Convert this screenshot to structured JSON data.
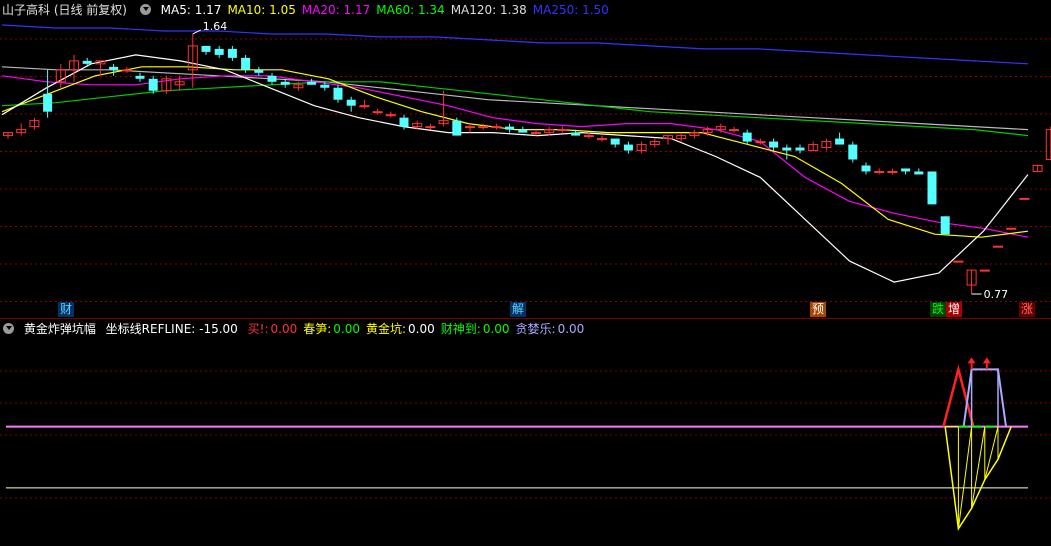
{
  "main_panel": {
    "title": "山子高科 (日线 前复权)",
    "ma_legend": [
      {
        "label": "MA5: 1.17",
        "color": "#ffffff"
      },
      {
        "label": "MA10: 1.05",
        "color": "#ffff00"
      },
      {
        "label": "MA20: 1.17",
        "color": "#ff00ff"
      },
      {
        "label": "MA60: 1.34",
        "color": "#00ff00"
      },
      {
        "label": "MA120: 1.38",
        "color": "#dddddd"
      },
      {
        "label": "MA250: 1.50",
        "color": "#3333ff"
      }
    ],
    "high_label": "1.64",
    "low_label": "0.77",
    "markers": [
      {
        "text": "财",
        "color": "#66ccff",
        "bg": "#003366"
      },
      {
        "text": "解",
        "color": "#66ccff",
        "bg": "#003366"
      },
      {
        "text": "预",
        "color": "#ffffff",
        "bg": "#aa4400"
      },
      {
        "text": "跌",
        "color": "#00ff00",
        "bg": "#004400"
      },
      {
        "text": "增",
        "color": "#ffffff",
        "bg": "#aa0000"
      },
      {
        "text": "涨",
        "color": "#ff6666",
        "bg": "#660000"
      }
    ]
  },
  "indicator_panel": {
    "title": "黄金炸弹坑幅",
    "ref_label": "坐标线REFLINE: -15.00",
    "fields": [
      {
        "label": "买!:",
        "value": "0.00",
        "label_color": "#ff3333",
        "value_color": "#ff3333"
      },
      {
        "label": "春笋:",
        "value": "0.00",
        "label_color": "#ffff00",
        "value_color": "#00ff00"
      },
      {
        "label": "黄金坑:",
        "value": "0.00",
        "label_color": "#ffff00",
        "value_color": "#ffffff"
      },
      {
        "label": "财神到:",
        "value": "0.00",
        "label_color": "#00ff00",
        "value_color": "#00ff00"
      },
      {
        "label": "贪婪乐:",
        "value": "0.00",
        "label_color": "#aaaaff",
        "value_color": "#aaaaff"
      }
    ]
  },
  "chart_data": {
    "type": "candlestick",
    "up_color": "#ff3333",
    "down_color": "#54ffff",
    "bars": [
      [
        1.3,
        1.31,
        1.29,
        1.31
      ],
      [
        1.31,
        1.34,
        1.3,
        1.32
      ],
      [
        1.33,
        1.36,
        1.32,
        1.35
      ],
      [
        1.44,
        1.52,
        1.36,
        1.38
      ],
      [
        1.48,
        1.54,
        1.46,
        1.52
      ],
      [
        1.52,
        1.57,
        1.48,
        1.55
      ],
      [
        1.55,
        1.56,
        1.53,
        1.54
      ],
      [
        1.54,
        1.55,
        1.5,
        1.55
      ],
      [
        1.53,
        1.54,
        1.5,
        1.52
      ],
      [
        1.52,
        1.53,
        1.51,
        1.52
      ],
      [
        1.5,
        1.51,
        1.48,
        1.49
      ],
      [
        1.49,
        1.5,
        1.44,
        1.45
      ],
      [
        1.45,
        1.5,
        1.44,
        1.49
      ],
      [
        1.47,
        1.5,
        1.45,
        1.48
      ],
      [
        1.52,
        1.64,
        1.46,
        1.6
      ],
      [
        1.6,
        1.6,
        1.57,
        1.58
      ],
      [
        1.59,
        1.6,
        1.56,
        1.57
      ],
      [
        1.59,
        1.6,
        1.55,
        1.56
      ],
      [
        1.56,
        1.57,
        1.51,
        1.52
      ],
      [
        1.52,
        1.53,
        1.5,
        1.51
      ],
      [
        1.5,
        1.51,
        1.47,
        1.48
      ],
      [
        1.48,
        1.49,
        1.46,
        1.47
      ],
      [
        1.46,
        1.48,
        1.45,
        1.47
      ],
      [
        1.48,
        1.49,
        1.47,
        1.47
      ],
      [
        1.47,
        1.48,
        1.45,
        1.46
      ],
      [
        1.46,
        1.47,
        1.41,
        1.42
      ],
      [
        1.42,
        1.43,
        1.38,
        1.4
      ],
      [
        1.4,
        1.42,
        1.39,
        1.4
      ],
      [
        1.38,
        1.39,
        1.37,
        1.38
      ],
      [
        1.37,
        1.38,
        1.36,
        1.37
      ],
      [
        1.36,
        1.37,
        1.32,
        1.33
      ],
      [
        1.33,
        1.35,
        1.32,
        1.34
      ],
      [
        1.33,
        1.34,
        1.32,
        1.33
      ],
      [
        1.34,
        1.45,
        1.33,
        1.35
      ],
      [
        1.35,
        1.36,
        1.3,
        1.3
      ],
      [
        1.33,
        1.34,
        1.31,
        1.33
      ],
      [
        1.33,
        1.34,
        1.32,
        1.33
      ],
      [
        1.33,
        1.34,
        1.32,
        1.33
      ],
      [
        1.33,
        1.34,
        1.31,
        1.32
      ],
      [
        1.32,
        1.33,
        1.31,
        1.31
      ],
      [
        1.31,
        1.32,
        1.3,
        1.31
      ],
      [
        1.31,
        1.33,
        1.3,
        1.32
      ],
      [
        1.32,
        1.33,
        1.31,
        1.32
      ],
      [
        1.31,
        1.32,
        1.3,
        1.3
      ],
      [
        1.3,
        1.31,
        1.29,
        1.3
      ],
      [
        1.29,
        1.3,
        1.28,
        1.29
      ],
      [
        1.29,
        1.29,
        1.26,
        1.27
      ],
      [
        1.27,
        1.28,
        1.24,
        1.25
      ],
      [
        1.25,
        1.28,
        1.24,
        1.27
      ],
      [
        1.27,
        1.29,
        1.26,
        1.28
      ],
      [
        1.29,
        1.3,
        1.27,
        1.3
      ],
      [
        1.29,
        1.31,
        1.28,
        1.3
      ],
      [
        1.3,
        1.32,
        1.29,
        1.31
      ],
      [
        1.31,
        1.33,
        1.3,
        1.32
      ],
      [
        1.32,
        1.34,
        1.31,
        1.33
      ],
      [
        1.32,
        1.33,
        1.31,
        1.32
      ],
      [
        1.31,
        1.32,
        1.27,
        1.28
      ],
      [
        1.28,
        1.29,
        1.27,
        1.28
      ],
      [
        1.28,
        1.29,
        1.25,
        1.26
      ],
      [
        1.26,
        1.27,
        1.22,
        1.25
      ],
      [
        1.26,
        1.27,
        1.24,
        1.25
      ],
      [
        1.25,
        1.28,
        1.25,
        1.27
      ],
      [
        1.26,
        1.29,
        1.25,
        1.28
      ],
      [
        1.29,
        1.31,
        1.27,
        1.27
      ],
      [
        1.27,
        1.28,
        1.21,
        1.22
      ],
      [
        1.2,
        1.21,
        1.17,
        1.18
      ],
      [
        1.18,
        1.19,
        1.17,
        1.18
      ],
      [
        1.18,
        1.19,
        1.17,
        1.18
      ],
      [
        1.19,
        1.19,
        1.17,
        1.18
      ],
      [
        1.18,
        1.19,
        1.17,
        1.17
      ],
      [
        1.18,
        1.18,
        1.07,
        1.07
      ],
      [
        1.03,
        1.03,
        0.97,
        0.97
      ],
      [
        0.88,
        0.88,
        0.88,
        0.88
      ],
      [
        0.8,
        0.85,
        0.77,
        0.85
      ],
      [
        0.85,
        0.85,
        0.85,
        0.85
      ],
      [
        0.93,
        0.93,
        0.93,
        0.93
      ],
      [
        0.99,
        0.99,
        0.99,
        0.99
      ],
      [
        1.09,
        1.09,
        1.09,
        1.09
      ],
      [
        1.18,
        1.2,
        1.18,
        1.2
      ],
      [
        1.22,
        1.33,
        1.22,
        1.32
      ]
    ],
    "ylim": [
      0.75,
      1.68
    ],
    "ma_series": [
      {
        "name": "MA250",
        "color": "#3333ff",
        "values": [
          1.67,
          1.66,
          1.66,
          1.65,
          1.65,
          1.64,
          1.64,
          1.63,
          1.63,
          1.62,
          1.61,
          1.61,
          1.6,
          1.59,
          1.59,
          1.58,
          1.57,
          1.56,
          1.55,
          1.54
        ]
      },
      {
        "name": "MA120",
        "color": "#bbbbbb",
        "values": [
          1.53,
          1.52,
          1.52,
          1.51,
          1.5,
          1.49,
          1.48,
          1.46,
          1.44,
          1.42,
          1.41,
          1.4,
          1.39,
          1.38,
          1.37,
          1.36,
          1.35,
          1.34,
          1.33,
          1.32
        ]
      },
      {
        "name": "MA60",
        "color": "#00cc00",
        "values": [
          1.4,
          1.41,
          1.43,
          1.45,
          1.46,
          1.47,
          1.48,
          1.48,
          1.46,
          1.44,
          1.42,
          1.4,
          1.38,
          1.37,
          1.36,
          1.35,
          1.34,
          1.33,
          1.32,
          1.3
        ]
      },
      {
        "name": "MA20",
        "color": "#ff00ff",
        "values": [
          1.5,
          1.48,
          1.47,
          1.47,
          1.49,
          1.5,
          1.5,
          1.48,
          1.46,
          1.43,
          1.4,
          1.36,
          1.34,
          1.33,
          1.34,
          1.34,
          1.32,
          1.28,
          1.16,
          1.08,
          1.04,
          1.01,
          0.99,
          0.96
        ]
      },
      {
        "name": "MA10",
        "color": "#ffff00",
        "values": [
          1.38,
          1.44,
          1.5,
          1.53,
          1.53,
          1.52,
          1.52,
          1.49,
          1.43,
          1.38,
          1.34,
          1.32,
          1.32,
          1.31,
          1.31,
          1.31,
          1.27,
          1.23,
          1.14,
          1.02,
          0.97,
          0.96,
          0.98
        ]
      },
      {
        "name": "MA5",
        "color": "#ffffff",
        "values": [
          1.37,
          1.46,
          1.54,
          1.57,
          1.55,
          1.52,
          1.46,
          1.4,
          1.36,
          1.33,
          1.31,
          1.31,
          1.3,
          1.31,
          1.3,
          1.29,
          1.23,
          1.16,
          1.02,
          0.88,
          0.81,
          0.84,
          0.98,
          1.17
        ]
      }
    ],
    "indicator": {
      "ref_value": -15,
      "signal_value": 0,
      "ylim": [
        -28,
        19
      ],
      "buy_peaks": [
        {
          "bar": 72,
          "value": 14
        }
      ],
      "greed_bars": [
        73,
        74,
        75
      ],
      "greed_value": 14,
      "pit_values": [
        [
          71,
          0
        ],
        [
          72,
          -25
        ],
        [
          73,
          -20
        ],
        [
          74,
          -13
        ],
        [
          75,
          -8
        ],
        [
          76,
          0
        ]
      ]
    }
  }
}
